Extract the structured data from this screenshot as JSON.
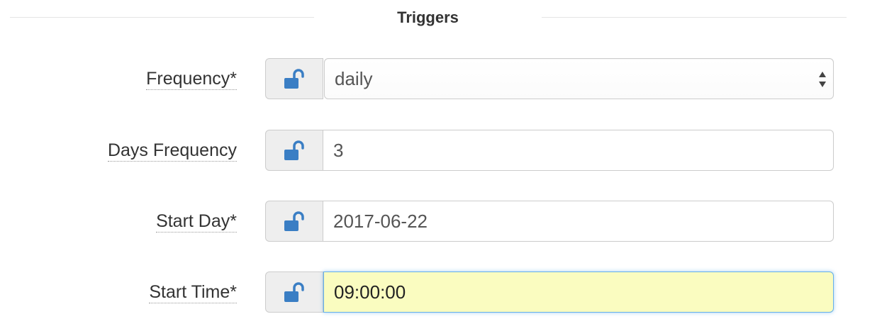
{
  "section": {
    "title": "Triggers"
  },
  "fields": [
    {
      "label": "Frequency*",
      "value": "daily",
      "type": "select",
      "lock_icon": "unlock-icon"
    },
    {
      "label": "Days Frequency",
      "value": "3",
      "type": "text",
      "lock_icon": "unlock-icon"
    },
    {
      "label": "Start Day*",
      "value": "2017-06-22",
      "type": "text",
      "lock_icon": "unlock-icon"
    },
    {
      "label": "Start Time*",
      "value": "09:00:00",
      "type": "text",
      "focused": true,
      "lock_icon": "unlock-icon"
    }
  ],
  "colors": {
    "lock_icon": "#3a7ec4",
    "focused_bg": "#fafcc0",
    "focused_border": "#66afe9"
  }
}
